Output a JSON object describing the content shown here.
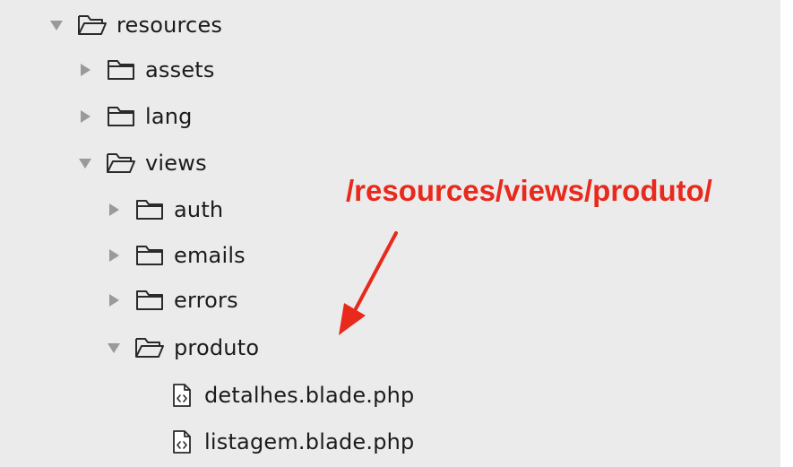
{
  "tree": {
    "items": [
      {
        "label": "resources",
        "kind": "folder",
        "expanded": true,
        "icon": "folder-open-icon",
        "disclosure": "disclosure-expanded-icon"
      },
      {
        "label": "assets",
        "kind": "folder",
        "expanded": false,
        "icon": "folder-icon",
        "disclosure": "disclosure-collapsed-icon"
      },
      {
        "label": "lang",
        "kind": "folder",
        "expanded": false,
        "icon": "folder-icon",
        "disclosure": "disclosure-collapsed-icon"
      },
      {
        "label": "views",
        "kind": "folder",
        "expanded": true,
        "icon": "folder-open-icon",
        "disclosure": "disclosure-expanded-icon"
      },
      {
        "label": "auth",
        "kind": "folder",
        "expanded": false,
        "icon": "folder-icon",
        "disclosure": "disclosure-collapsed-icon"
      },
      {
        "label": "emails",
        "kind": "folder",
        "expanded": false,
        "icon": "folder-icon",
        "disclosure": "disclosure-collapsed-icon"
      },
      {
        "label": "errors",
        "kind": "folder",
        "expanded": false,
        "icon": "folder-icon",
        "disclosure": "disclosure-collapsed-icon"
      },
      {
        "label": "produto",
        "kind": "folder",
        "expanded": true,
        "icon": "folder-open-icon",
        "disclosure": "disclosure-expanded-icon"
      },
      {
        "label": "detalhes.blade.php",
        "kind": "file",
        "icon": "code-file-icon"
      },
      {
        "label": "listagem.blade.php",
        "kind": "file",
        "icon": "code-file-icon"
      }
    ]
  },
  "annotation": {
    "text": "/resources/views/produto/",
    "color": "#e8291c"
  },
  "colors": {
    "background": "#ebebeb",
    "label": "#1b1b1b",
    "disclosure": "#9a9a9a",
    "icon_stroke": "#2a2a2a",
    "accent": "#e8291c"
  }
}
